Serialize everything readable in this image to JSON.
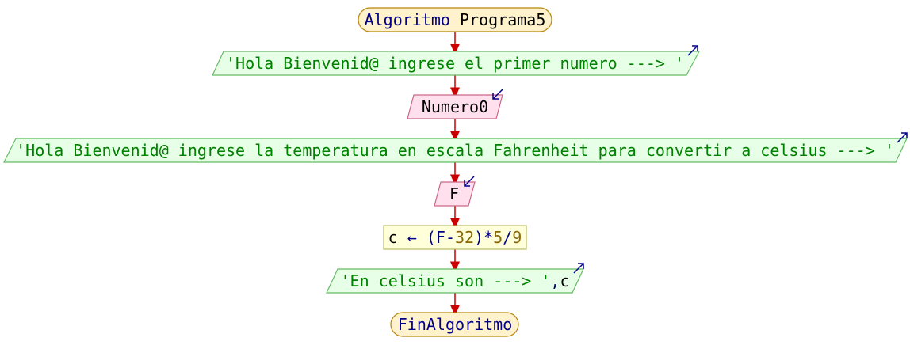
{
  "colors": {
    "keyword": "#00008b",
    "string": "#008000",
    "number": "#8b6508",
    "text": "#000000",
    "arrow": "#cc0000",
    "terminal_fill": "#fff2cc",
    "terminal_stroke": "#b8860b",
    "io_fill": "#e6ffe6",
    "io_stroke": "#66bb66",
    "input_fill": "#ffe0ec",
    "input_stroke": "#cc6688",
    "process_fill": "#ffffd9",
    "process_stroke": "#bbbb66"
  },
  "flow": {
    "start": {
      "keyword": "Algoritmo",
      "name": "Programa5"
    },
    "write1": {
      "text": "'Hola Bienvenid@ ingrese el primer numero ---> '"
    },
    "read1": {
      "text": "Numero0"
    },
    "write2": {
      "text": "'Hola Bienvenid@ ingrese la temperatura en escala Fahrenheit para convertir a celsius ---> '"
    },
    "read2": {
      "text": "F"
    },
    "assign": {
      "var": "c",
      "arrow": "←",
      "open": "(F-",
      "n32": "32",
      "mid": ")*",
      "n5": "5",
      "slash": "/",
      "n9": "9"
    },
    "write3": {
      "text": "'En celsius son ---> '",
      "sep": ",",
      "var": "c"
    },
    "end": {
      "keyword": "FinAlgoritmo"
    }
  }
}
